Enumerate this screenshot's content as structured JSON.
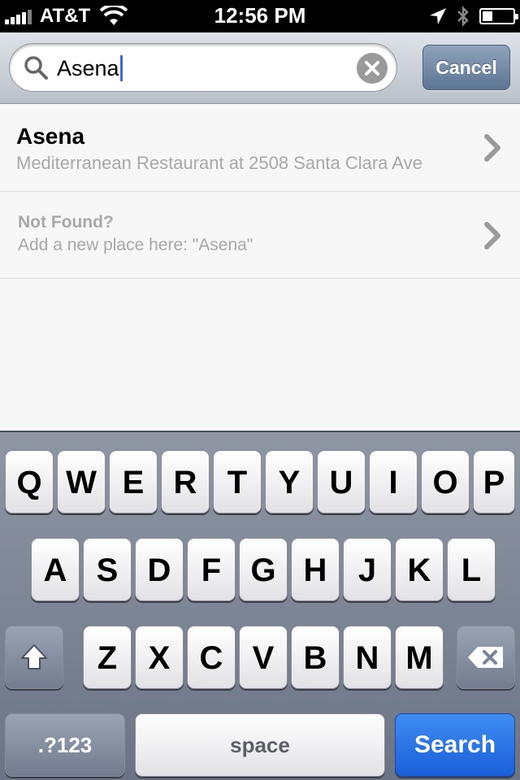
{
  "status_bar": {
    "carrier": "AT&T",
    "time": "12:56 PM"
  },
  "search": {
    "query": "Asena",
    "cancel_label": "Cancel"
  },
  "results": [
    {
      "title": "Asena",
      "subtitle": "Mediterranean Restaurant at 2508 Santa Clara Ave"
    },
    {
      "title": "Not Found?",
      "subtitle": "Add a new place here: \"Asena\""
    }
  ],
  "keyboard": {
    "row1": [
      "Q",
      "W",
      "E",
      "R",
      "T",
      "Y",
      "U",
      "I",
      "O",
      "P"
    ],
    "row2": [
      "A",
      "S",
      "D",
      "F",
      "G",
      "H",
      "J",
      "K",
      "L"
    ],
    "row3": [
      "Z",
      "X",
      "C",
      "V",
      "B",
      "N",
      "M"
    ],
    "numbers_label": ".?123",
    "space_label": "space",
    "search_label": "Search"
  },
  "colors": {
    "accent_blue": "#2a6fe6",
    "cancel_button": "#6f86a5"
  }
}
